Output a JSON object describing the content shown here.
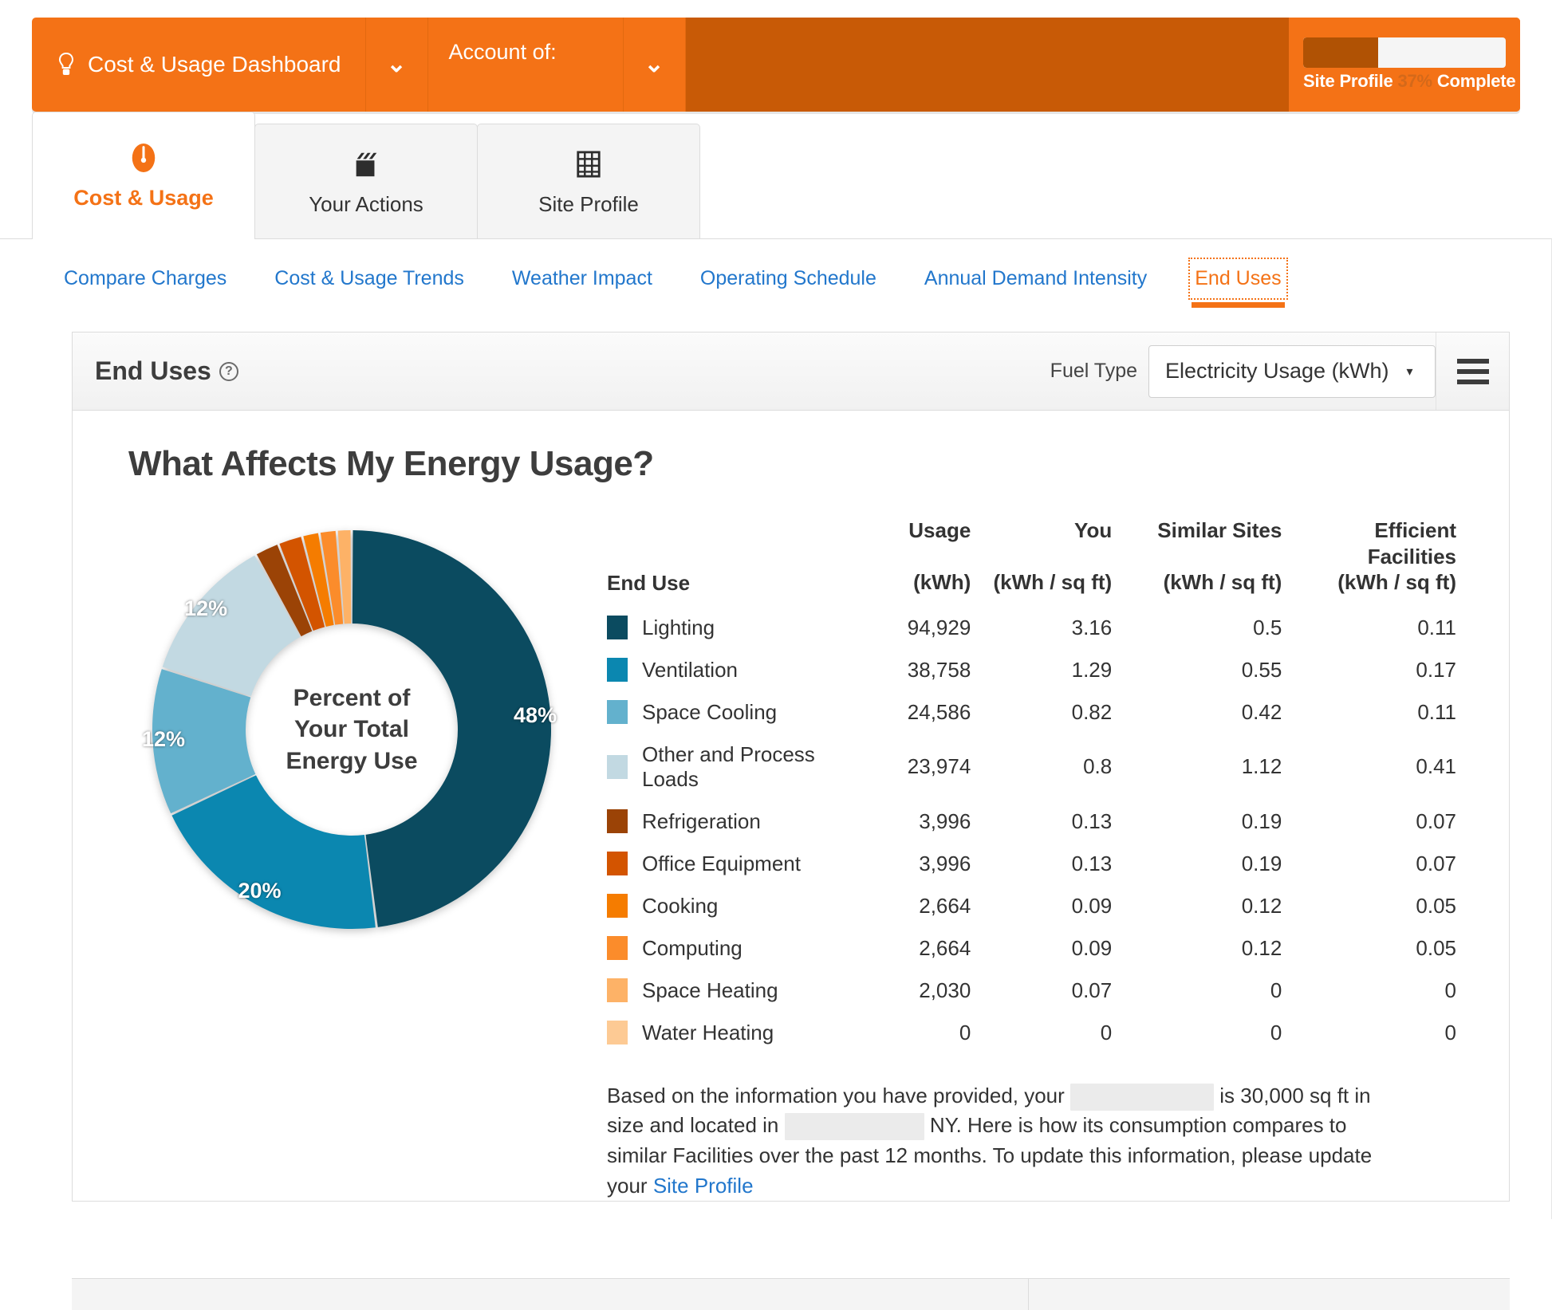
{
  "header": {
    "dashboard_label": "Cost & Usage Dashboard",
    "dashboard_icon": "lightbulb-icon",
    "dashboard_caret": "⌄",
    "account_label": "Account of:",
    "account_caret": "⌄",
    "profile_caption_prefix": "Site Profile",
    "profile_percent": "37%",
    "profile_caption_suffix": "Complete",
    "profile_progress_value": 37,
    "brand_color": "#f47216",
    "brand_dark_color": "#c85a06"
  },
  "tabs": [
    {
      "label": "Cost & Usage",
      "icon": "gauge-icon",
      "active": true
    },
    {
      "label": "Your Actions",
      "icon": "clapperboard-icon",
      "active": false
    },
    {
      "label": "Site Profile",
      "icon": "building-grid-icon",
      "active": false
    }
  ],
  "subnav": [
    {
      "label": "Compare Charges",
      "active": false
    },
    {
      "label": "Cost & Usage Trends",
      "active": false
    },
    {
      "label": "Weather Impact",
      "active": false
    },
    {
      "label": "Operating Schedule",
      "active": false
    },
    {
      "label": "Annual Demand Intensity",
      "active": false
    },
    {
      "label": "End Uses",
      "active": true
    }
  ],
  "card": {
    "title": "End Uses",
    "help_icon": "question-mark-icon",
    "fuel_type_label": "Fuel Type",
    "fuel_type_value": "Electricity Usage (kWh)",
    "fuel_type_caret": "▾",
    "menu_icon": "hamburger-menu-icon",
    "heading": "What Affects My Energy Usage?"
  },
  "table": {
    "headers": {
      "category": "End Use",
      "usage_top": "Usage",
      "usage_sub": "(kWh)",
      "you_top": "You",
      "you_sub": "(kWh / sq ft)",
      "similar_top": "Similar Sites",
      "similar_sub": "(kWh / sq ft)",
      "efficient_top": "Efficient",
      "efficient_top2": "Facilities",
      "efficient_sub": "(kWh / sq ft)"
    },
    "rows": [
      {
        "label": "Lighting",
        "color": "#0b4b60",
        "usage": "94,929",
        "you": "3.16",
        "similar": "0.5",
        "efficient": "0.11"
      },
      {
        "label": "Ventilation",
        "color": "#0b87b0",
        "usage": "38,758",
        "you": "1.29",
        "similar": "0.55",
        "efficient": "0.17"
      },
      {
        "label": "Space Cooling",
        "color": "#63b1cd",
        "usage": "24,586",
        "you": "0.82",
        "similar": "0.42",
        "efficient": "0.11"
      },
      {
        "label": "Other and Process Loads",
        "color": "#c2d9e2",
        "usage": "23,974",
        "you": "0.8",
        "similar": "1.12",
        "efficient": "0.41"
      },
      {
        "label": "Refrigeration",
        "color": "#9b4306",
        "usage": "3,996",
        "you": "0.13",
        "similar": "0.19",
        "efficient": "0.07"
      },
      {
        "label": "Office Equipment",
        "color": "#d35400",
        "usage": "3,996",
        "you": "0.13",
        "similar": "0.19",
        "efficient": "0.07"
      },
      {
        "label": "Cooking",
        "color": "#f57c00",
        "usage": "2,664",
        "you": "0.09",
        "similar": "0.12",
        "efficient": "0.05"
      },
      {
        "label": "Computing",
        "color": "#fb8c2b",
        "usage": "2,664",
        "you": "0.09",
        "similar": "0.12",
        "efficient": "0.05"
      },
      {
        "label": "Space Heating",
        "color": "#fdb267",
        "usage": "2,030",
        "you": "0.07",
        "similar": "0",
        "efficient": "0"
      },
      {
        "label": "Water Heating",
        "color": "#fdca94",
        "usage": "0",
        "you": "0",
        "similar": "0",
        "efficient": "0"
      }
    ]
  },
  "chart_data": {
    "type": "pie",
    "title": "Percent of Your Total Energy Use",
    "center_lines": [
      "Percent of",
      "Your Total",
      "Energy Use"
    ],
    "legend_position": "right",
    "categories": [
      "Lighting",
      "Ventilation",
      "Space Cooling",
      "Other and Process Loads",
      "Refrigeration",
      "Office Equipment",
      "Cooking",
      "Computing",
      "Space Heating",
      "Water Heating"
    ],
    "values": [
      48,
      20,
      12,
      12,
      2,
      2,
      1.4,
      1.4,
      1.2,
      0
    ],
    "value_unit": "percent",
    "visible_labels": [
      "48%",
      "20%",
      "12%",
      "12%"
    ],
    "colors": [
      "#0b4b60",
      "#0b87b0",
      "#63b1cd",
      "#c2d9e2",
      "#9b4306",
      "#d35400",
      "#f57c00",
      "#fb8c2b",
      "#fdb267",
      "#fdca94"
    ],
    "raw_usage_kwh": [
      94929,
      38758,
      24586,
      23974,
      3996,
      3996,
      2664,
      2664,
      2030,
      0
    ]
  },
  "footnote": {
    "part1": "Based on the information you have provided, your",
    "redacted1": "",
    "part2": "is 30,000 sq ft in size and located in",
    "redacted2": "",
    "part3": "NY. Here is how its consumption compares to similar Facilities over the past 12 months.",
    "part4": "To update this information, please update your",
    "link": "Site Profile"
  }
}
